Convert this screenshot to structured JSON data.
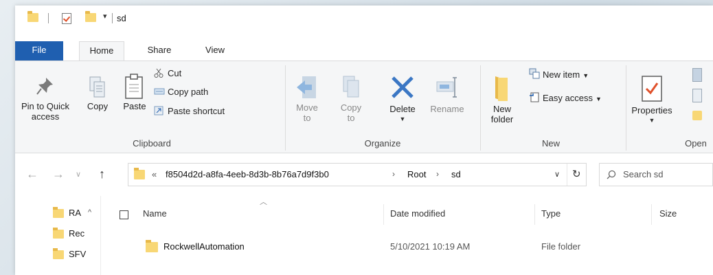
{
  "window": {
    "title": "sd",
    "qat_dropdown": "▾"
  },
  "tabs": {
    "file": "File",
    "home": "Home",
    "share": "Share",
    "view": "View"
  },
  "ribbon": {
    "clipboard": {
      "pin": "Pin to Quick access",
      "copy": "Copy",
      "paste": "Paste",
      "cut": "Cut",
      "copy_path": "Copy path",
      "paste_shortcut": "Paste shortcut",
      "label": "Clipboard"
    },
    "organize": {
      "move_to": "Move to",
      "copy_to": "Copy to",
      "delete": "Delete",
      "rename": "Rename",
      "label": "Organize"
    },
    "new": {
      "new_folder": "New folder",
      "new_item": "New item",
      "easy_access": "Easy access",
      "label": "New"
    },
    "open": {
      "properties": "Properties",
      "label": "Open"
    }
  },
  "address": {
    "overflow": "«",
    "crumbs": [
      "f8504d2d-a8fa-4eeb-8d3b-8b76a7d9f3b0",
      "Root",
      "sd"
    ],
    "search_placeholder": "Search sd"
  },
  "navpane": {
    "items": [
      "RA",
      "Rec",
      "SFV"
    ]
  },
  "columns": {
    "name": "Name",
    "date_modified": "Date modified",
    "type": "Type",
    "size": "Size"
  },
  "files": [
    {
      "name": "RockwellAutomation",
      "date_modified": "5/10/2021 10:19 AM",
      "type": "File folder",
      "size": ""
    }
  ],
  "colors": {
    "file_tab": "#1f5fb0",
    "folder": "#f8d775",
    "folder_dark": "#e8b94a",
    "delete_x": "#1f5fb0",
    "check": "#e0502a"
  }
}
